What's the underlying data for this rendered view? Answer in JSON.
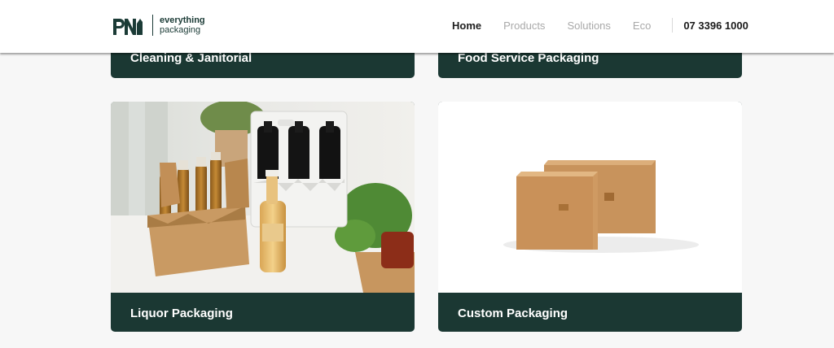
{
  "brand": {
    "mark": "PNI",
    "tagline_line1": "everything",
    "tagline_line2": "packaging"
  },
  "nav": {
    "items": [
      {
        "label": "Home",
        "active": true
      },
      {
        "label": "Products",
        "active": false
      },
      {
        "label": "Solutions",
        "active": false
      },
      {
        "label": "Eco",
        "active": false
      }
    ],
    "phone": "07 3396 1000"
  },
  "categories": [
    {
      "label": "Cleaning & Janitorial"
    },
    {
      "label": "Food Service Packaging"
    },
    {
      "label": "Liquor Packaging"
    },
    {
      "label": "Custom Packaging"
    }
  ],
  "colors": {
    "card_footer": "#1b3833",
    "brand_dark": "#1b3b36"
  }
}
